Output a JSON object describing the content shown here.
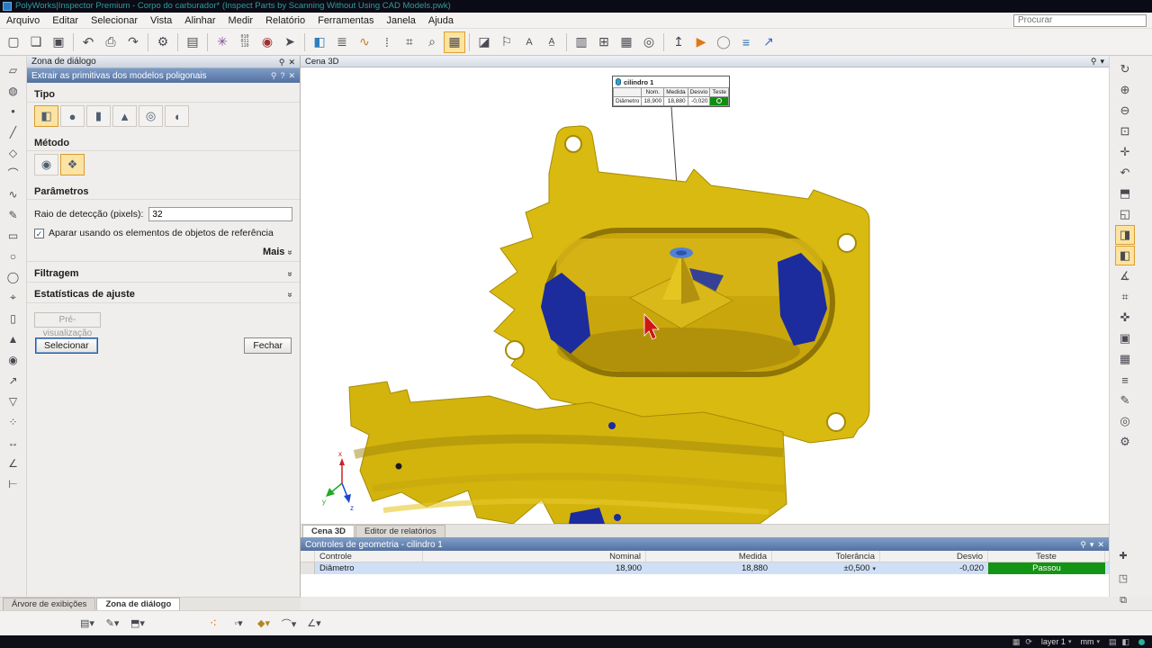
{
  "window_icons": {
    "pin": "⚲",
    "close": "✕",
    "help": "?",
    "menu": "▾",
    "check": "✓",
    "chevron_more": "»"
  },
  "colors": {
    "part_yellow": "#d9ba10",
    "part_blue": "#1c2c9c",
    "pass_green": "#149414",
    "selection_blue": "#cfe0f6",
    "accent_orange": "#dc9f33"
  },
  "title_bar": {
    "title": "PolyWorks|Inspector Premium - Corpo do carburador* (Inspect Parts by Scanning Without Using CAD Models.pwk)"
  },
  "menu_bar": {
    "items": [
      "Arquivo",
      "Editar",
      "Selecionar",
      "Vista",
      "Alinhar",
      "Medir",
      "Relatório",
      "Ferramentas",
      "Janela",
      "Ajuda"
    ],
    "search_placeholder": "Procurar"
  },
  "main_toolbar": {
    "icons": [
      {
        "name": "new-file-icon",
        "glyph": "▢"
      },
      {
        "name": "open-file-icon",
        "glyph": "❏"
      },
      {
        "name": "save-icon",
        "glyph": "▣"
      },
      {
        "sep": true
      },
      {
        "name": "undo-icon",
        "glyph": "↶",
        "size": 15
      },
      {
        "name": "print-icon",
        "glyph": "⎙"
      },
      {
        "name": "redo-icon",
        "glyph": "↷"
      },
      {
        "sep": true
      },
      {
        "name": "options-gear-icon",
        "glyph": "⚙"
      },
      {
        "sep": true
      },
      {
        "name": "clipboard-icon",
        "glyph": "▤"
      },
      {
        "sep": true
      },
      {
        "name": "probe-star-icon",
        "glyph": "✳",
        "color": "#8a4aa0"
      },
      {
        "name": "digital-readout-icon",
        "glyph": "010\n011\n110",
        "size": 5,
        "pre": true
      },
      {
        "name": "gauge-icon",
        "glyph": "◉",
        "color": "#a03030"
      },
      {
        "name": "probe-arrow-icon",
        "glyph": "➤"
      },
      {
        "sep": true
      },
      {
        "name": "reference-cube-icon",
        "glyph": "◧",
        "color": "#2f7fbf"
      },
      {
        "name": "scan-comb-icon",
        "glyph": "≣"
      },
      {
        "name": "color-comb-icon",
        "glyph": "∿",
        "color": "#d07820"
      },
      {
        "name": "pins-icon",
        "glyph": "⁞"
      },
      {
        "name": "select-elements-icon",
        "glyph": "⌗"
      },
      {
        "name": "zoom-tool-icon",
        "glyph": "⌕"
      },
      {
        "name": "grid-align-icon",
        "glyph": "▦",
        "active": true
      },
      {
        "sep": true
      },
      {
        "name": "surface-icon",
        "glyph": "◪"
      },
      {
        "name": "flag-icon",
        "glyph": "⚐"
      },
      {
        "name": "find-text-icon",
        "glyph": "A",
        "size": 11
      },
      {
        "name": "font-search-icon",
        "glyph": "A̲",
        "size": 10
      },
      {
        "sep": true
      },
      {
        "name": "report-item-icon",
        "glyph": "▥"
      },
      {
        "name": "report-add-icon",
        "glyph": "⊞"
      },
      {
        "name": "table-icon",
        "glyph": "▦"
      },
      {
        "name": "camera-icon",
        "glyph": "◎"
      },
      {
        "sep": true
      },
      {
        "name": "export-icon",
        "glyph": "↥",
        "color": "#445"
      },
      {
        "name": "play-macro-icon",
        "glyph": "▶",
        "color": "#e07818"
      },
      {
        "name": "stop-macro-icon",
        "glyph": "◯",
        "color": "#888"
      },
      {
        "name": "macro-list-icon",
        "glyph": "≡",
        "color": "#2f6fb0"
      },
      {
        "name": "chart-icon",
        "glyph": "↗",
        "color": "#3a6ac0"
      }
    ]
  },
  "left_toolbar": {
    "icons": [
      {
        "name": "surface-patch-icon",
        "glyph": "▱"
      },
      {
        "name": "sphere-probe-icon",
        "glyph": "◍"
      },
      {
        "name": "point-icon",
        "glyph": "●",
        "size": 8
      },
      {
        "name": "line-icon",
        "glyph": "╱"
      },
      {
        "name": "plane-icon",
        "glyph": "◇"
      },
      {
        "name": "arc-icon",
        "glyph": "⌒"
      },
      {
        "name": "curve-icon",
        "glyph": "∿"
      },
      {
        "name": "pencil-icon",
        "glyph": "✎"
      },
      {
        "name": "slab-icon",
        "glyph": "▭"
      },
      {
        "name": "circle-icon",
        "glyph": "○"
      },
      {
        "name": "ellipse-icon",
        "glyph": "◯"
      },
      {
        "name": "crosshair-icon",
        "glyph": "⌖"
      },
      {
        "name": "cylinder-icon",
        "glyph": "▯"
      },
      {
        "name": "cone-icon",
        "glyph": "▲"
      },
      {
        "name": "sphere-icon",
        "glyph": "◉"
      },
      {
        "name": "vector-icon",
        "glyph": "↗"
      },
      {
        "name": "polygon-icon",
        "glyph": "▽"
      },
      {
        "name": "cluster-icon",
        "glyph": "⁘"
      },
      {
        "name": "distance-icon",
        "glyph": "↔"
      },
      {
        "name": "angle-icon",
        "glyph": "∠"
      },
      {
        "name": "caliper-icon",
        "glyph": "⊢"
      }
    ]
  },
  "right_toolbar": {
    "icons": [
      {
        "name": "rotate-view-icon",
        "glyph": "↻"
      },
      {
        "name": "zoom-in-icon",
        "glyph": "⊕"
      },
      {
        "name": "zoom-out-icon",
        "glyph": "⊖"
      },
      {
        "name": "zoom-window-icon",
        "glyph": "⊡"
      },
      {
        "name": "pan-icon",
        "glyph": "✛"
      },
      {
        "name": "previous-view-icon",
        "glyph": "↶"
      },
      {
        "name": "standard-views-icon",
        "glyph": "⬒"
      },
      {
        "name": "perspective-icon",
        "glyph": "◱"
      },
      {
        "name": "show-primitives-icon",
        "glyph": "◨",
        "active": true
      },
      {
        "name": "split-view-icon",
        "glyph": "◧",
        "active": true
      },
      {
        "name": "measure-view-icon",
        "glyph": "∡"
      },
      {
        "name": "ruler-icon",
        "glyph": "⌗"
      },
      {
        "name": "hand-icon",
        "glyph": "✜"
      },
      {
        "name": "box-zoom-icon",
        "glyph": "▣"
      },
      {
        "name": "mesh-view-icon",
        "glyph": "▦"
      },
      {
        "name": "layers-icon",
        "glyph": "≡"
      },
      {
        "name": "annotation-icon",
        "glyph": "✎"
      },
      {
        "name": "snapshot-view-icon",
        "glyph": "◎"
      },
      {
        "name": "view-settings-icon",
        "glyph": "⚙"
      }
    ],
    "lower_icons": [
      {
        "name": "add-control-icon",
        "glyph": "✚"
      },
      {
        "name": "control-options-icon",
        "glyph": "◳"
      },
      {
        "name": "export-table-icon",
        "glyph": "⧉"
      }
    ]
  },
  "dialog_panel": {
    "header": "Zona de diálogo",
    "subheader": "Extrair as primitivas dos modelos poligonais",
    "sections": {
      "tipo": "Tipo",
      "metodo": "Método",
      "parametros": "Parâmetros"
    },
    "tipo_icons": [
      {
        "name": "type-plane-icon",
        "glyph": "◧",
        "active": true
      },
      {
        "name": "type-sphere-icon",
        "glyph": "●"
      },
      {
        "name": "type-cylinder-icon",
        "glyph": "▮"
      },
      {
        "name": "type-cone-icon",
        "glyph": "▲"
      },
      {
        "name": "type-circle-icon",
        "glyph": "◎"
      },
      {
        "name": "type-slot-icon",
        "glyph": "◖"
      }
    ],
    "metodo_icons": [
      {
        "name": "method-anchor-icon",
        "glyph": "◉"
      },
      {
        "name": "method-auto-icon",
        "glyph": "❖",
        "active": true
      }
    ],
    "radius_label": "Raio de detecção (pixels):",
    "radius_value": "32",
    "trim_checkbox_label": "Aparar usando os elementos de objetos de referência",
    "more_label": "Mais",
    "expanders": [
      "Filtragem",
      "Estatísticas de ajuste"
    ],
    "preview_button": "Pré-visualização",
    "select_button": "Selecionar",
    "close_button": "Fechar"
  },
  "viewport": {
    "header": "Cena 3D",
    "tabs": [
      {
        "label": "Cena 3D",
        "active": true
      },
      {
        "label": "Editor de relatórios",
        "active": false
      }
    ],
    "callout": {
      "title": "cilindro 1",
      "headers": [
        "",
        "Nom.",
        "Medida",
        "Desvio",
        "Teste"
      ],
      "row": [
        "Diâmetro",
        "18,900",
        "18,880",
        "-0,020"
      ]
    },
    "axis": {
      "x": "x",
      "y": "y",
      "z": "z"
    }
  },
  "bottom_panel": {
    "header": "Controles de geometria - cilindro 1",
    "table": {
      "headers": [
        "Controle",
        "Nominal",
        "Medida",
        "Tolerância",
        "Desvio",
        "Teste"
      ],
      "row": {
        "controle": "Diâmetro",
        "nominal": "18,900",
        "medida": "18,880",
        "tolerancia": "±0,500",
        "desvio": "-0,020",
        "teste": "Passou"
      }
    }
  },
  "bottom_tabs": [
    {
      "label": "Árvore de exibições",
      "active": false
    },
    {
      "label": "Zona de diálogo",
      "active": true
    }
  ],
  "bottom_toolbar": {
    "icons": [
      {
        "name": "report-menu-icon",
        "glyph": "▤▾"
      },
      {
        "name": "annotation-menu-icon",
        "glyph": "✎▾"
      },
      {
        "name": "object-menu-icon",
        "glyph": "⬒▾"
      },
      {
        "name": "measure-cluster-icon",
        "glyph": "⁖",
        "color": "#e07818",
        "gap": 56,
        "size": 14
      },
      {
        "name": "point-menu-icon",
        "glyph": "◦▾"
      },
      {
        "name": "feature-menu-icon",
        "glyph": "◆▾",
        "color": "#b08820"
      },
      {
        "name": "profile-menu-icon",
        "glyph": "⌒▾"
      },
      {
        "name": "angle-menu-icon",
        "glyph": "∠▾"
      }
    ]
  },
  "status_bar": {
    "icons_a": [
      {
        "name": "status-grid-icon",
        "glyph": "▦"
      },
      {
        "name": "status-refresh-icon",
        "glyph": "⟳"
      }
    ],
    "layer_label": "layer 1",
    "units_label": "mm",
    "icons_b": [
      {
        "name": "status-report-icon",
        "glyph": "▤"
      },
      {
        "name": "status-view-icon",
        "glyph": "◧"
      }
    ]
  }
}
